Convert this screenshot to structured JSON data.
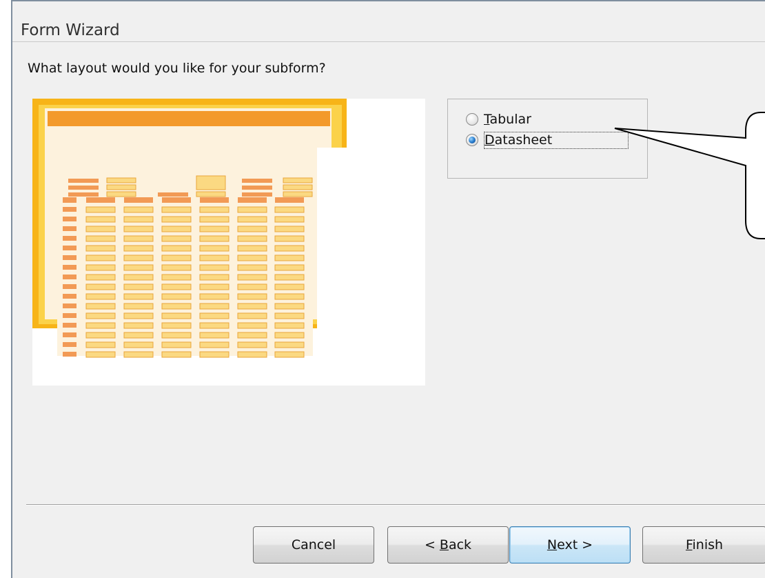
{
  "dialog": {
    "title": "Form Wizard",
    "question": "What layout would you like for your subform?"
  },
  "layout_options": [
    {
      "label": "Tabular",
      "mnemonic": "T",
      "rest": "abular",
      "selected": false
    },
    {
      "label": "Datasheet",
      "mnemonic": "D",
      "rest": "atasheet",
      "selected": true
    }
  ],
  "buttons": {
    "cancel": {
      "label": "Cancel"
    },
    "back": {
      "pre": "< ",
      "mnemonic": "B",
      "rest": "ack"
    },
    "next": {
      "mnemonic": "N",
      "rest": "ext >"
    },
    "finish": {
      "mnemonic": "F",
      "rest": "inish"
    }
  },
  "preview": {
    "icon": "datasheet-layout-preview",
    "colors": {
      "frame": "#f7b418",
      "header": "#f39a2b",
      "background": "#fdf2dd",
      "cell": "#fbd982",
      "label": "#f29a55"
    }
  }
}
